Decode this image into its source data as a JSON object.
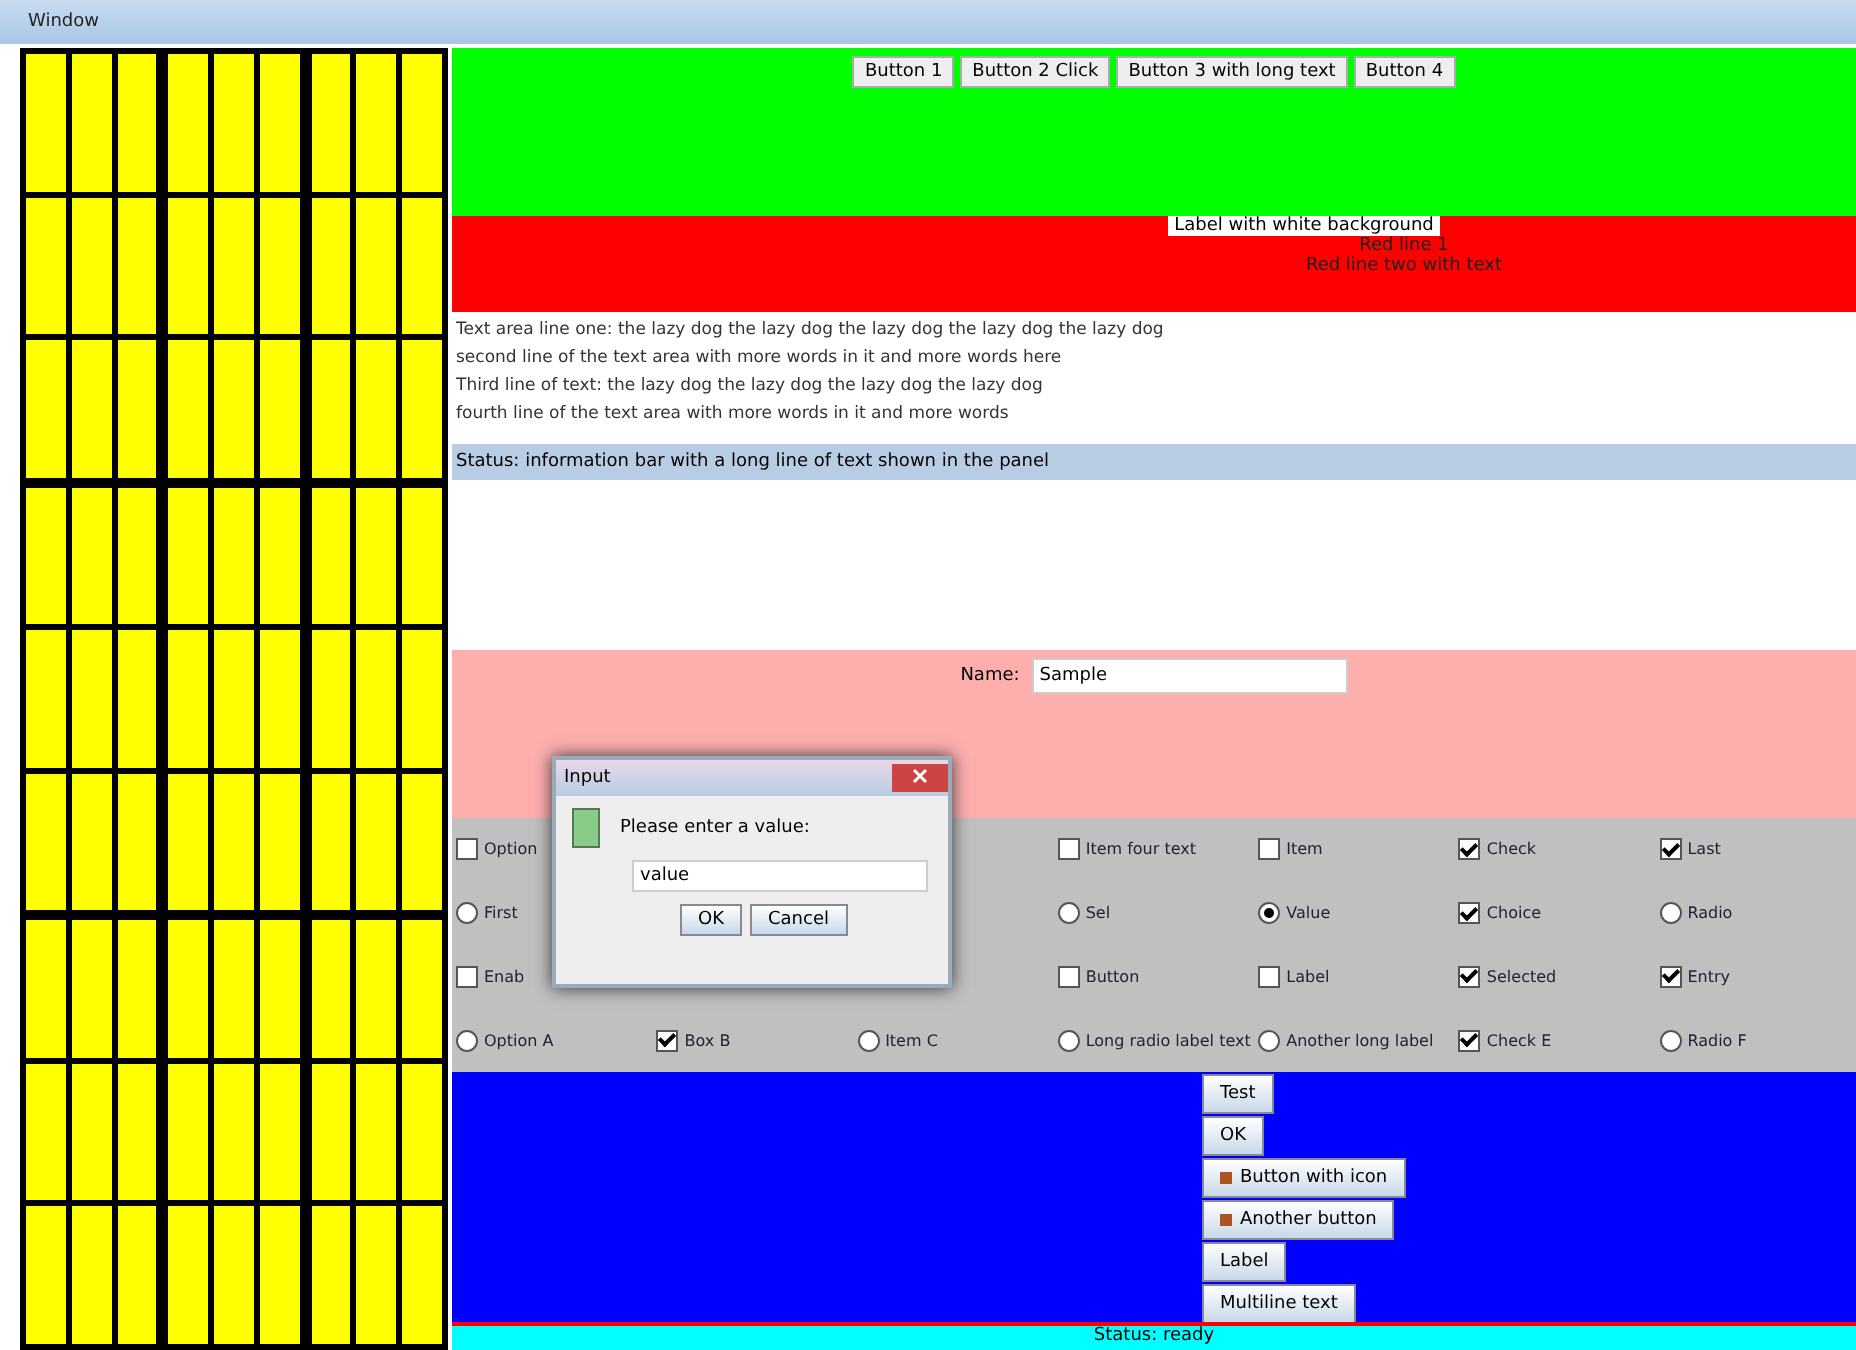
{
  "window": {
    "title": "Window"
  },
  "top_buttons": [
    "Button 1",
    "Button 2 Click",
    "Button 3 with long text",
    "Button 4"
  ],
  "header": {
    "label": "Label with white background",
    "lines": [
      "Red line 1",
      "Red line two with text"
    ]
  },
  "text_area": {
    "lines": [
      "Text area line one: the lazy dog the lazy dog the lazy dog the lazy dog the lazy dog",
      "second line of the text area with more words in it and more words here",
      "Third line of text: the lazy dog the lazy dog the lazy dog the lazy dog",
      "fourth line of the text area with more words in it and more words"
    ]
  },
  "info_bar": "Status: information bar with a long line of text shown in the panel",
  "form": {
    "label": "Name:",
    "value": "Sample"
  },
  "options": [
    [
      {
        "kind": "check",
        "label": "Option",
        "checked": false
      },
      {
        "kind": "empty"
      },
      {
        "kind": "empty"
      },
      {
        "kind": "check",
        "label": "Item four text",
        "checked": false
      },
      {
        "kind": "check",
        "label": "Item",
        "checked": false
      },
      {
        "kind": "check",
        "label": "Check",
        "checked": true
      },
      {
        "kind": "check",
        "label": "Last",
        "checked": true
      }
    ],
    [
      {
        "kind": "radio",
        "label": "First",
        "checked": false
      },
      {
        "kind": "empty"
      },
      {
        "kind": "empty"
      },
      {
        "kind": "radio",
        "label": "Sel",
        "checked": false
      },
      {
        "kind": "radio",
        "label": "Value",
        "checked": true
      },
      {
        "kind": "check",
        "label": "Choice",
        "checked": true
      },
      {
        "kind": "radio",
        "label": "Radio",
        "checked": false
      }
    ],
    [
      {
        "kind": "check",
        "label": "Enab",
        "checked": false
      },
      {
        "kind": "empty"
      },
      {
        "kind": "empty"
      },
      {
        "kind": "check",
        "label": "Button",
        "checked": false
      },
      {
        "kind": "check",
        "label": "Label",
        "checked": false
      },
      {
        "kind": "check",
        "label": "Selected",
        "checked": true
      },
      {
        "kind": "check",
        "label": "Entry",
        "checked": true
      }
    ],
    [
      {
        "kind": "radio",
        "label": "Option A",
        "checked": false
      },
      {
        "kind": "check",
        "label": "Box B",
        "checked": true
      },
      {
        "kind": "radio",
        "label": "Item C",
        "checked": false
      },
      {
        "kind": "radio",
        "label": "Long radio label text",
        "checked": false
      },
      {
        "kind": "radio",
        "label": "Another long label",
        "checked": false
      },
      {
        "kind": "check",
        "label": "Check E",
        "checked": true
      },
      {
        "kind": "radio",
        "label": "Radio F",
        "checked": false
      }
    ]
  ],
  "action_buttons": [
    {
      "label": "Test",
      "icon": false
    },
    {
      "label": "OK",
      "icon": false
    },
    {
      "label": "Button with icon",
      "icon": true
    },
    {
      "label": "Another button",
      "icon": true
    },
    {
      "label": "Label",
      "icon": false
    },
    {
      "label": "Multiline text",
      "icon": false
    }
  ],
  "status_bar": "Status: ready",
  "dialog": {
    "title": "Input",
    "message": "Please enter a value:",
    "value": "value",
    "buttons": [
      "OK",
      "Cancel"
    ]
  }
}
